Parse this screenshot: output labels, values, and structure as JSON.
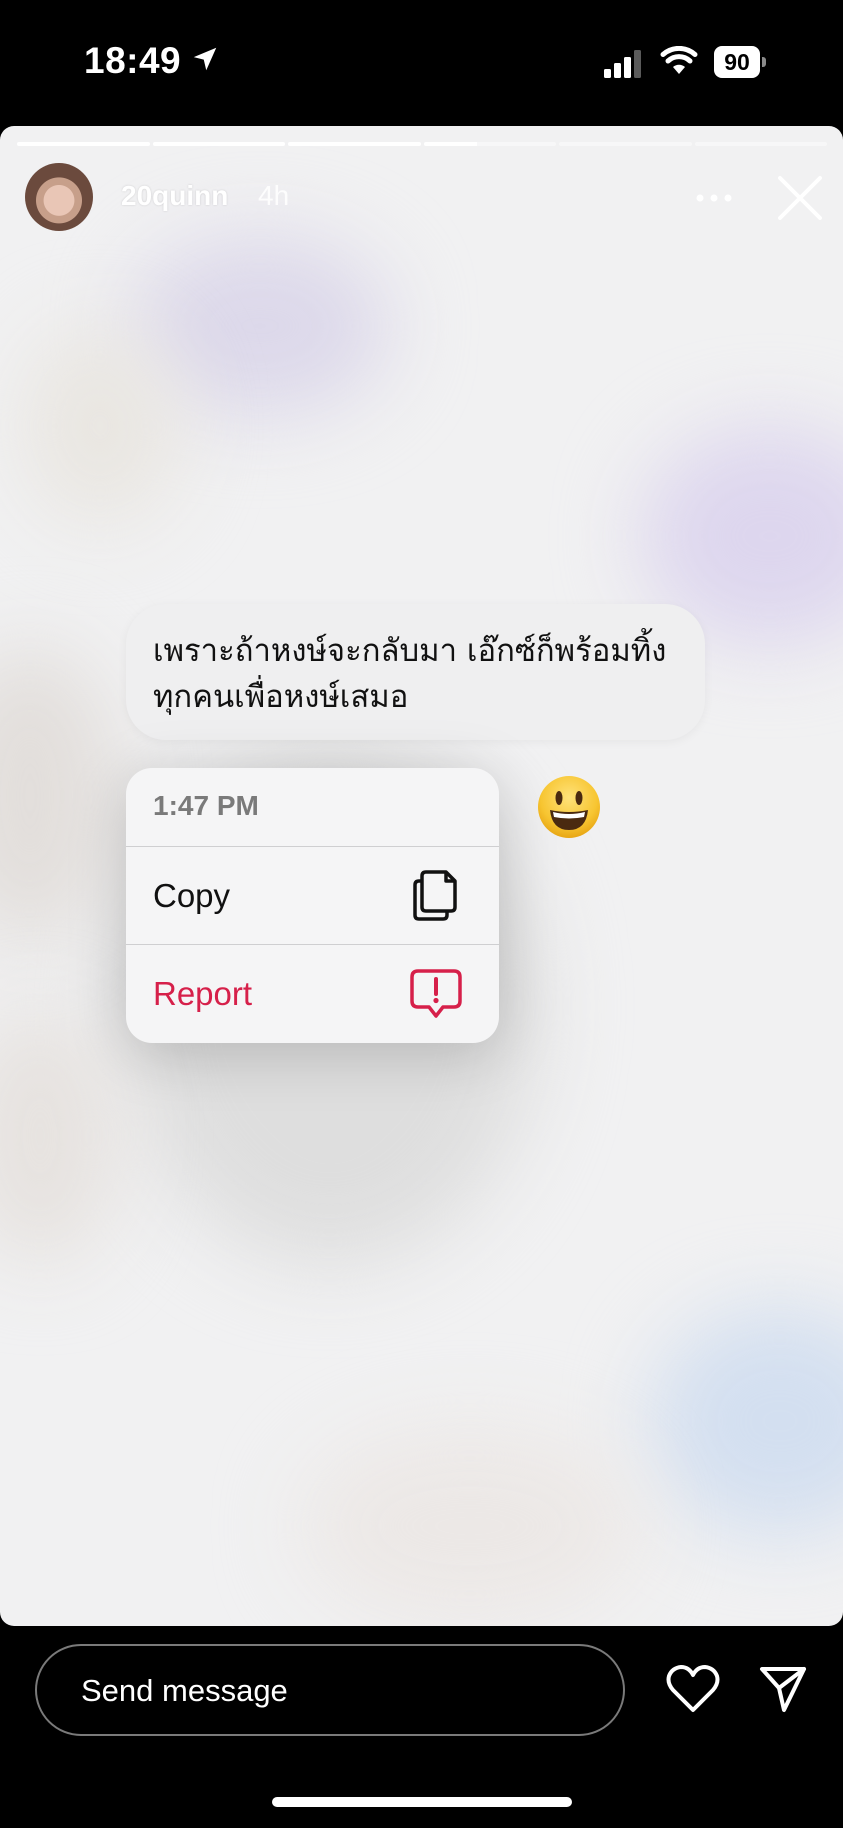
{
  "status_bar": {
    "time": "18:49",
    "battery": "90",
    "icons": [
      "location-arrow-icon",
      "cellular-signal-icon",
      "wifi-icon",
      "battery-icon"
    ]
  },
  "story": {
    "progress_segments": [
      1,
      1,
      1,
      0.4,
      0,
      0
    ],
    "username": "20quinn",
    "age": "4h",
    "icons": [
      "more-options-icon",
      "close-icon"
    ]
  },
  "message": {
    "text": "เพราะถ้าหงษ์จะกลับมา เอ๊กซ์ก็พร้อมทิ้งทุกคนเพื่อหงษ์เสมอ"
  },
  "context_menu": {
    "timestamp": "1:47 PM",
    "copy_label": "Copy",
    "report_label": "Report",
    "report_color": "#d6204a",
    "icons": [
      "copy-icon",
      "report-icon"
    ]
  },
  "reaction_emoji": "smiling-face-emoji",
  "bottom_bar": {
    "placeholder": "Send message",
    "icons": [
      "heart-icon",
      "send-icon"
    ]
  }
}
